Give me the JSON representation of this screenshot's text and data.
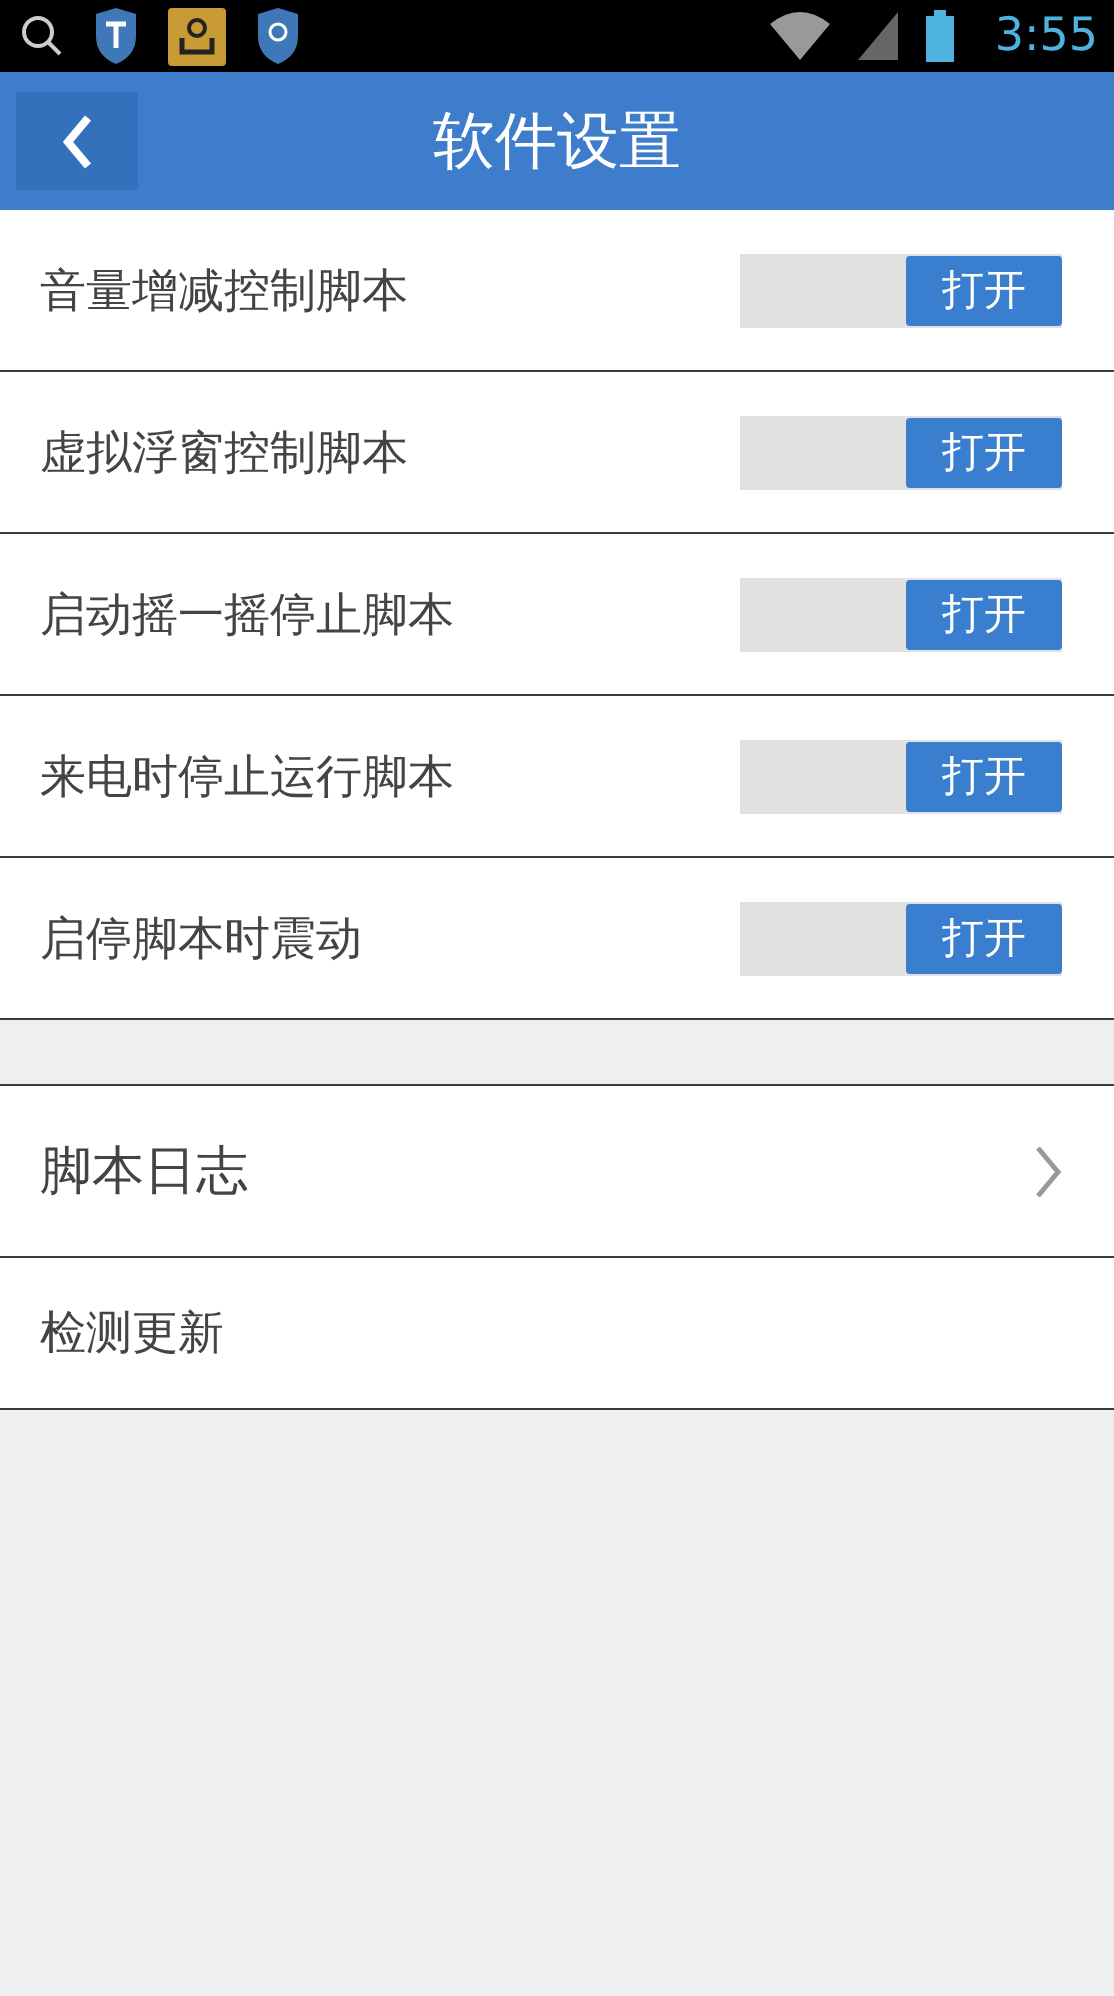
{
  "status_bar": {
    "time": "3:55"
  },
  "header": {
    "title": "软件设置"
  },
  "toggles": [
    {
      "label": "音量增减控制脚本",
      "on": true,
      "state_text": "打开"
    },
    {
      "label": "虚拟浮窗控制脚本",
      "on": true,
      "state_text": "打开"
    },
    {
      "label": "启动摇一摇停止脚本",
      "on": true,
      "state_text": "打开"
    },
    {
      "label": "来电时停止运行脚本",
      "on": true,
      "state_text": "打开"
    },
    {
      "label": "启停脚本时震动",
      "on": true,
      "state_text": "打开"
    }
  ],
  "links": [
    {
      "label": "脚本日志",
      "kind": "chevron"
    },
    {
      "label": "检测更新",
      "kind": "plain"
    }
  ]
}
